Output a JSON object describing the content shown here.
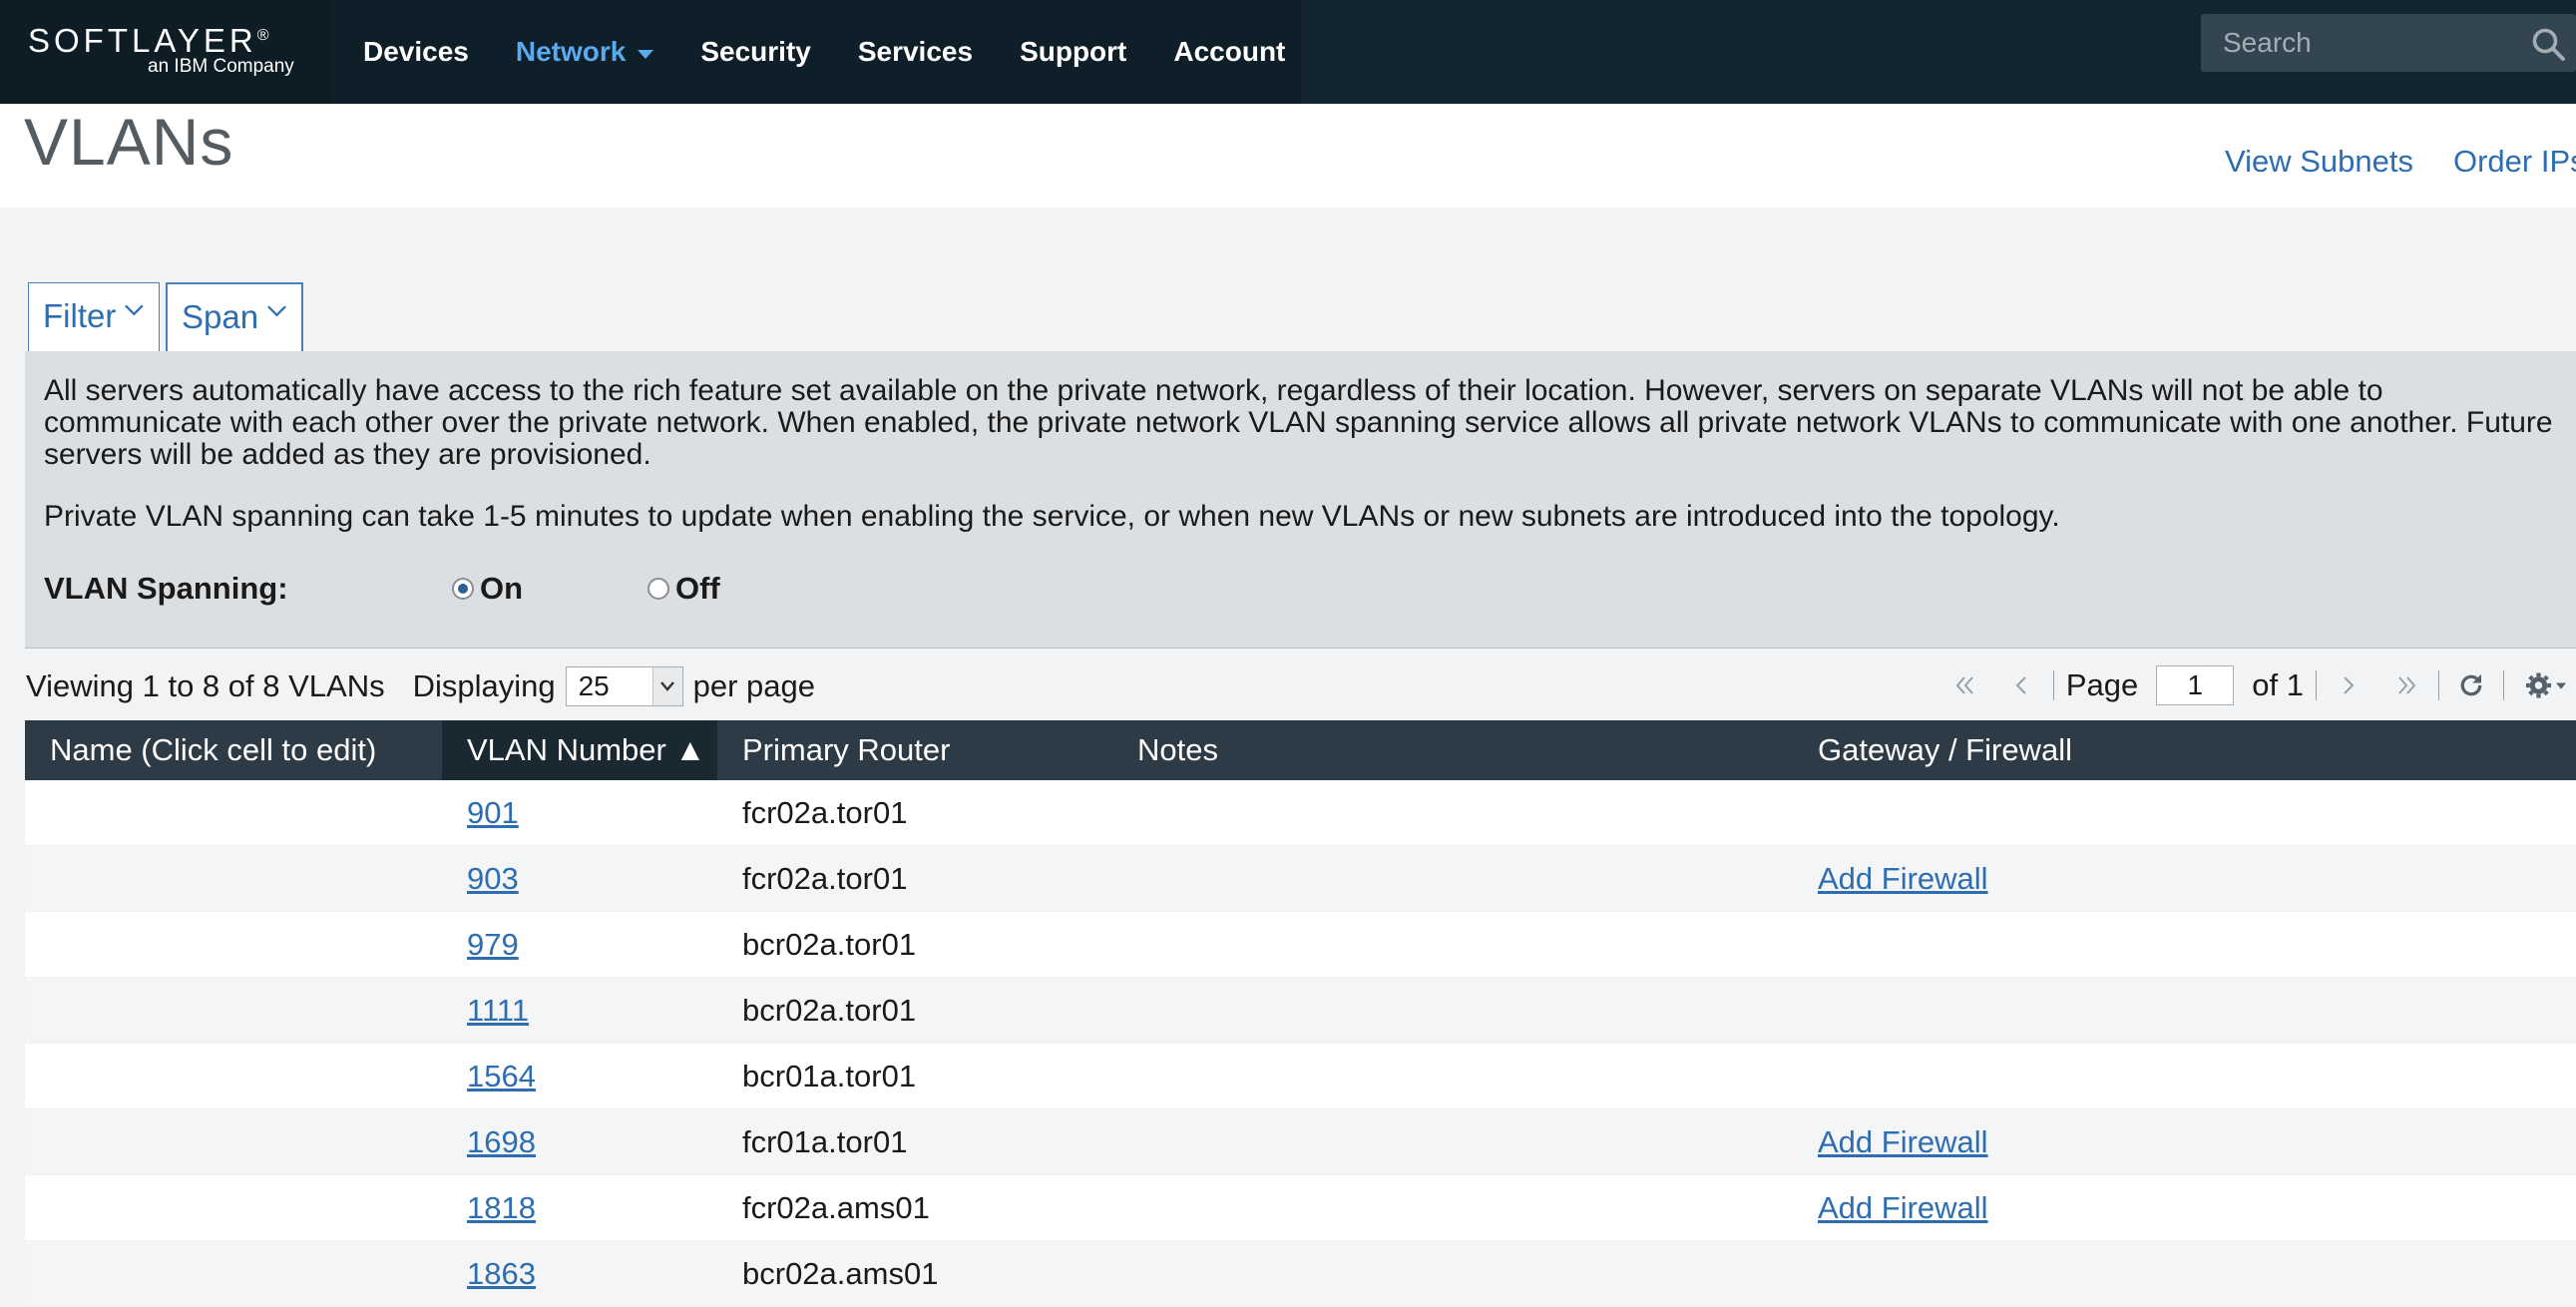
{
  "brand": {
    "name": "SOFTLAYER",
    "reg": "®",
    "sub": "an IBM Company"
  },
  "nav": [
    {
      "label": "Devices",
      "active": false
    },
    {
      "label": "Network",
      "active": true
    },
    {
      "label": "Security",
      "active": false
    },
    {
      "label": "Services",
      "active": false
    },
    {
      "label": "Support",
      "active": false
    },
    {
      "label": "Account",
      "active": false
    }
  ],
  "search": {
    "placeholder": "Search"
  },
  "page": {
    "title": "VLANs",
    "links": {
      "view_subnets": "View Subnets",
      "order_ips": "Order IPs"
    }
  },
  "tabs": {
    "filter": "Filter",
    "span": "Span"
  },
  "span_panel": {
    "description": "All servers automatically have access to the rich feature set available on the private network, regardless of their location. However, servers on separate VLANs will not be able to communicate with each other over the private network. When enabled, the private network VLAN spanning service allows all private network VLANs to communicate with one another. Future servers will be added as they are provisioned.",
    "note": "Private VLAN spanning can take 1-5 minutes to update when enabling the service, or when new VLANs or new subnets are introduced into the topology.",
    "label": "VLAN Spanning:",
    "on_label": "On",
    "off_label": "Off",
    "selected": "On"
  },
  "pager": {
    "viewing": "Viewing 1 to 8 of 8 VLANs",
    "displaying": "Displaying",
    "per_page_value": "25",
    "per_page": "per page",
    "page_label": "Page",
    "page_value": "1",
    "of_label": "of 1"
  },
  "table": {
    "columns": {
      "name": "Name (Click cell to edit)",
      "vlan": "VLAN Number ▲",
      "router": "Primary Router",
      "notes": "Notes",
      "gateway": "Gateway / Firewall"
    },
    "rows": [
      {
        "name": "",
        "vlan": "901",
        "router": "fcr02a.tor01",
        "notes": "",
        "gateway": ""
      },
      {
        "name": "",
        "vlan": "903",
        "router": "fcr02a.tor01",
        "notes": "",
        "gateway": "Add Firewall"
      },
      {
        "name": "",
        "vlan": "979",
        "router": "bcr02a.tor01",
        "notes": "",
        "gateway": ""
      },
      {
        "name": "",
        "vlan": "1111",
        "router": "bcr02a.tor01",
        "notes": "",
        "gateway": ""
      },
      {
        "name": "",
        "vlan": "1564",
        "router": "bcr01a.tor01",
        "notes": "",
        "gateway": ""
      },
      {
        "name": "",
        "vlan": "1698",
        "router": "fcr01a.tor01",
        "notes": "",
        "gateway": "Add Firewall"
      },
      {
        "name": "",
        "vlan": "1818",
        "router": "fcr02a.ams01",
        "notes": "",
        "gateway": "Add Firewall"
      },
      {
        "name": "",
        "vlan": "1863",
        "router": "bcr02a.ams01",
        "notes": "",
        "gateway": ""
      }
    ]
  }
}
